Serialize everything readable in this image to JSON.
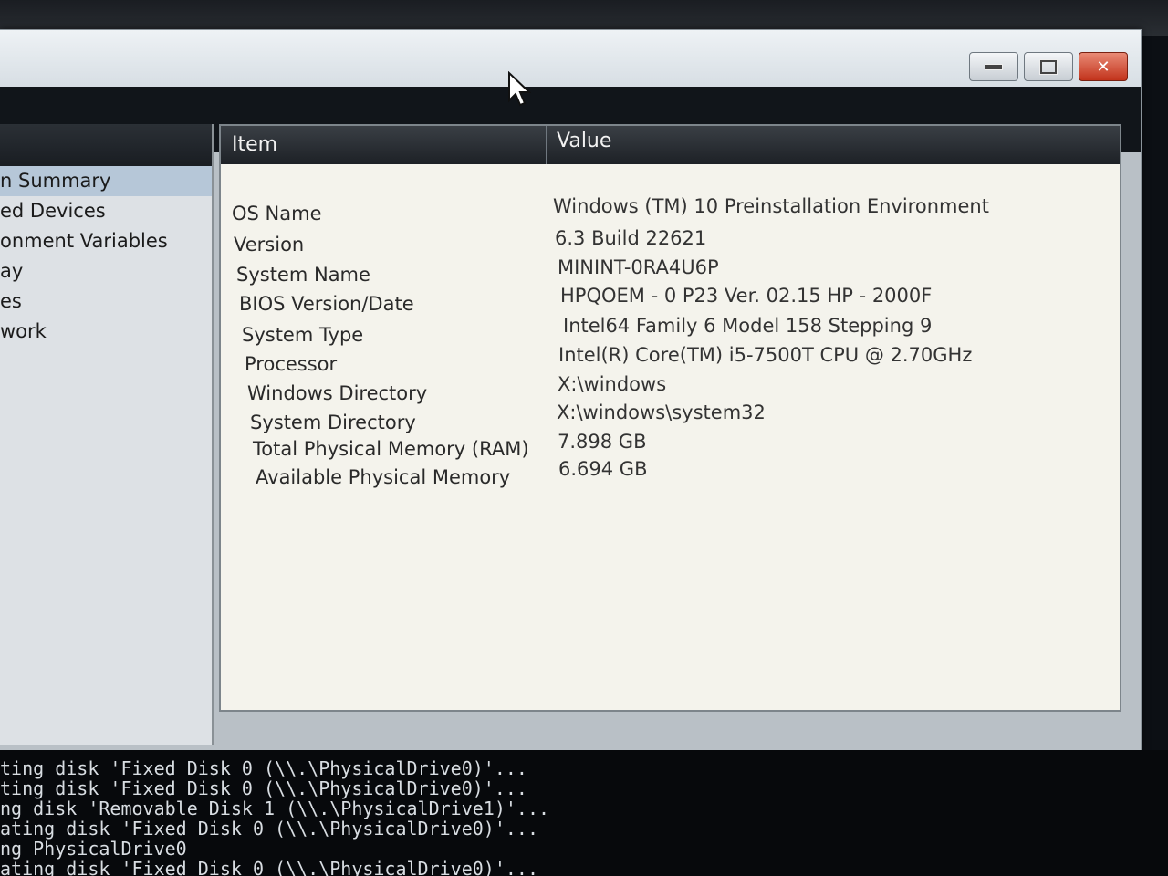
{
  "window": {
    "controls": {
      "minimize": "minimize-icon",
      "maximize": "maximize-icon",
      "close": "close-icon"
    }
  },
  "tree": {
    "items": [
      {
        "label": "n Summary",
        "selected": true
      },
      {
        "label": "ed Devices"
      },
      {
        "label": "onment Variables"
      },
      {
        "label": "ay"
      },
      {
        "label": "es"
      },
      {
        "label": "work"
      }
    ]
  },
  "list": {
    "columns": {
      "item": "Item",
      "value": "Value"
    },
    "rows": [
      {
        "item": "OS Name",
        "value": "Windows (TM) 10 Preinstallation Environment"
      },
      {
        "item": "Version",
        "value": "6.3 Build 22621"
      },
      {
        "item": "System Name",
        "value": "MININT-0RA4U6P"
      },
      {
        "item": "BIOS Version/Date",
        "value": "HPQOEM - 0 P23 Ver. 02.15 HP - 2000F"
      },
      {
        "item": "System Type",
        "value": "Intel64 Family 6 Model 158 Stepping 9"
      },
      {
        "item": "Processor",
        "value": "Intel(R) Core(TM) i5-7500T CPU @ 2.70GHz"
      },
      {
        "item": "Windows Directory",
        "value": "X:\\windows"
      },
      {
        "item": "System Directory",
        "value": "X:\\windows\\system32"
      },
      {
        "item": "Total Physical Memory (RAM)",
        "value": "7.898 GB"
      },
      {
        "item": "Available Physical Memory",
        "value": "6.694 GB"
      }
    ]
  },
  "console": {
    "lines": [
      "ting disk 'Fixed Disk 0 (\\\\.\\PhysicalDrive0)'...",
      "ting disk 'Fixed Disk 0 (\\\\.\\PhysicalDrive0)'...",
      "ng disk 'Removable Disk 1 (\\\\.\\PhysicalDrive1)'...",
      "ating disk 'Fixed Disk 0 (\\\\.\\PhysicalDrive0)'...",
      "ng PhysicalDrive0",
      "ating disk 'Fixed Disk 0 (\\\\.\\PhysicalDrive0)'..."
    ]
  }
}
